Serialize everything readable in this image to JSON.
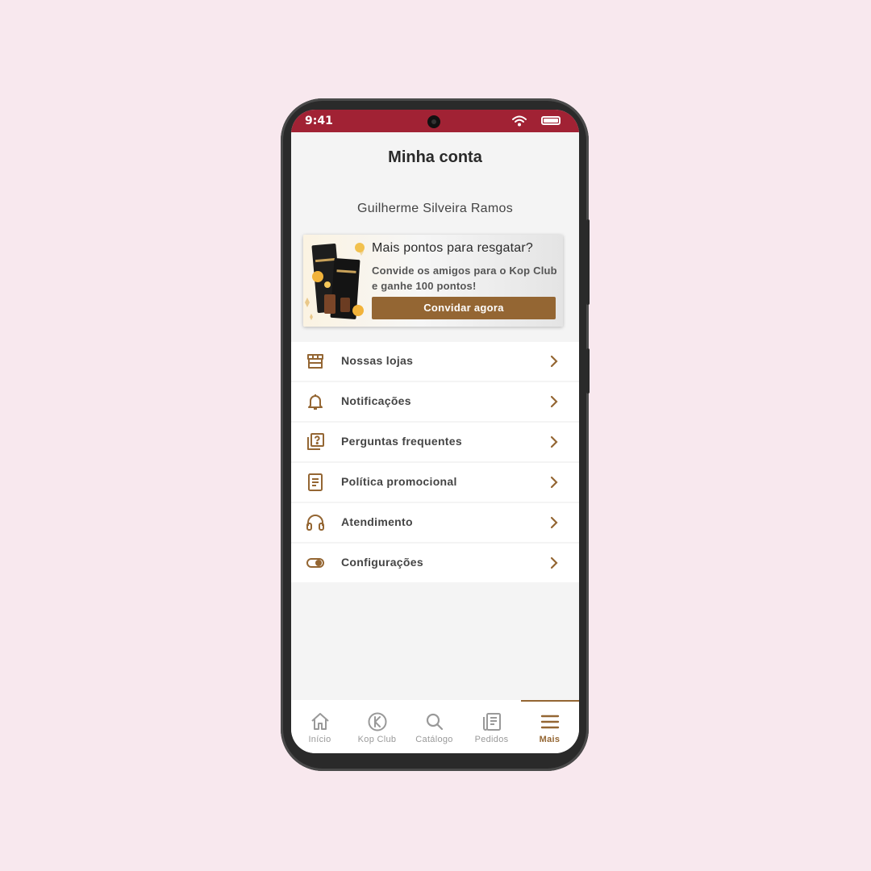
{
  "status_bar": {
    "time": "9:41"
  },
  "header": {
    "title": "Minha conta"
  },
  "user": {
    "name": "Guilherme Silveira Ramos"
  },
  "promo": {
    "title": "Mais pontos para resgatar?",
    "text": "Convide os amigos para o Kop Club e ganhe 100 pontos!",
    "button_label": "Convidar agora"
  },
  "menu": {
    "items": [
      {
        "label": "Nossas lojas",
        "icon": "store-icon"
      },
      {
        "label": "Notificações",
        "icon": "bell-icon"
      },
      {
        "label": "Perguntas frequentes",
        "icon": "faq-icon"
      },
      {
        "label": "Política promocional",
        "icon": "document-icon"
      },
      {
        "label": "Atendimento",
        "icon": "headset-icon"
      },
      {
        "label": "Configurações",
        "icon": "toggle-icon"
      }
    ]
  },
  "tabbar": {
    "items": [
      {
        "label": "Início",
        "icon": "home-icon"
      },
      {
        "label": "Kop Club",
        "icon": "kop-club-icon"
      },
      {
        "label": "Catálogo",
        "icon": "search-icon"
      },
      {
        "label": "Pedidos",
        "icon": "orders-icon"
      },
      {
        "label": "Mais",
        "icon": "menu-icon",
        "active": true
      }
    ]
  },
  "colors": {
    "accent": "#946633",
    "status_bar": "#a12234",
    "background": "#f8e8ee"
  }
}
